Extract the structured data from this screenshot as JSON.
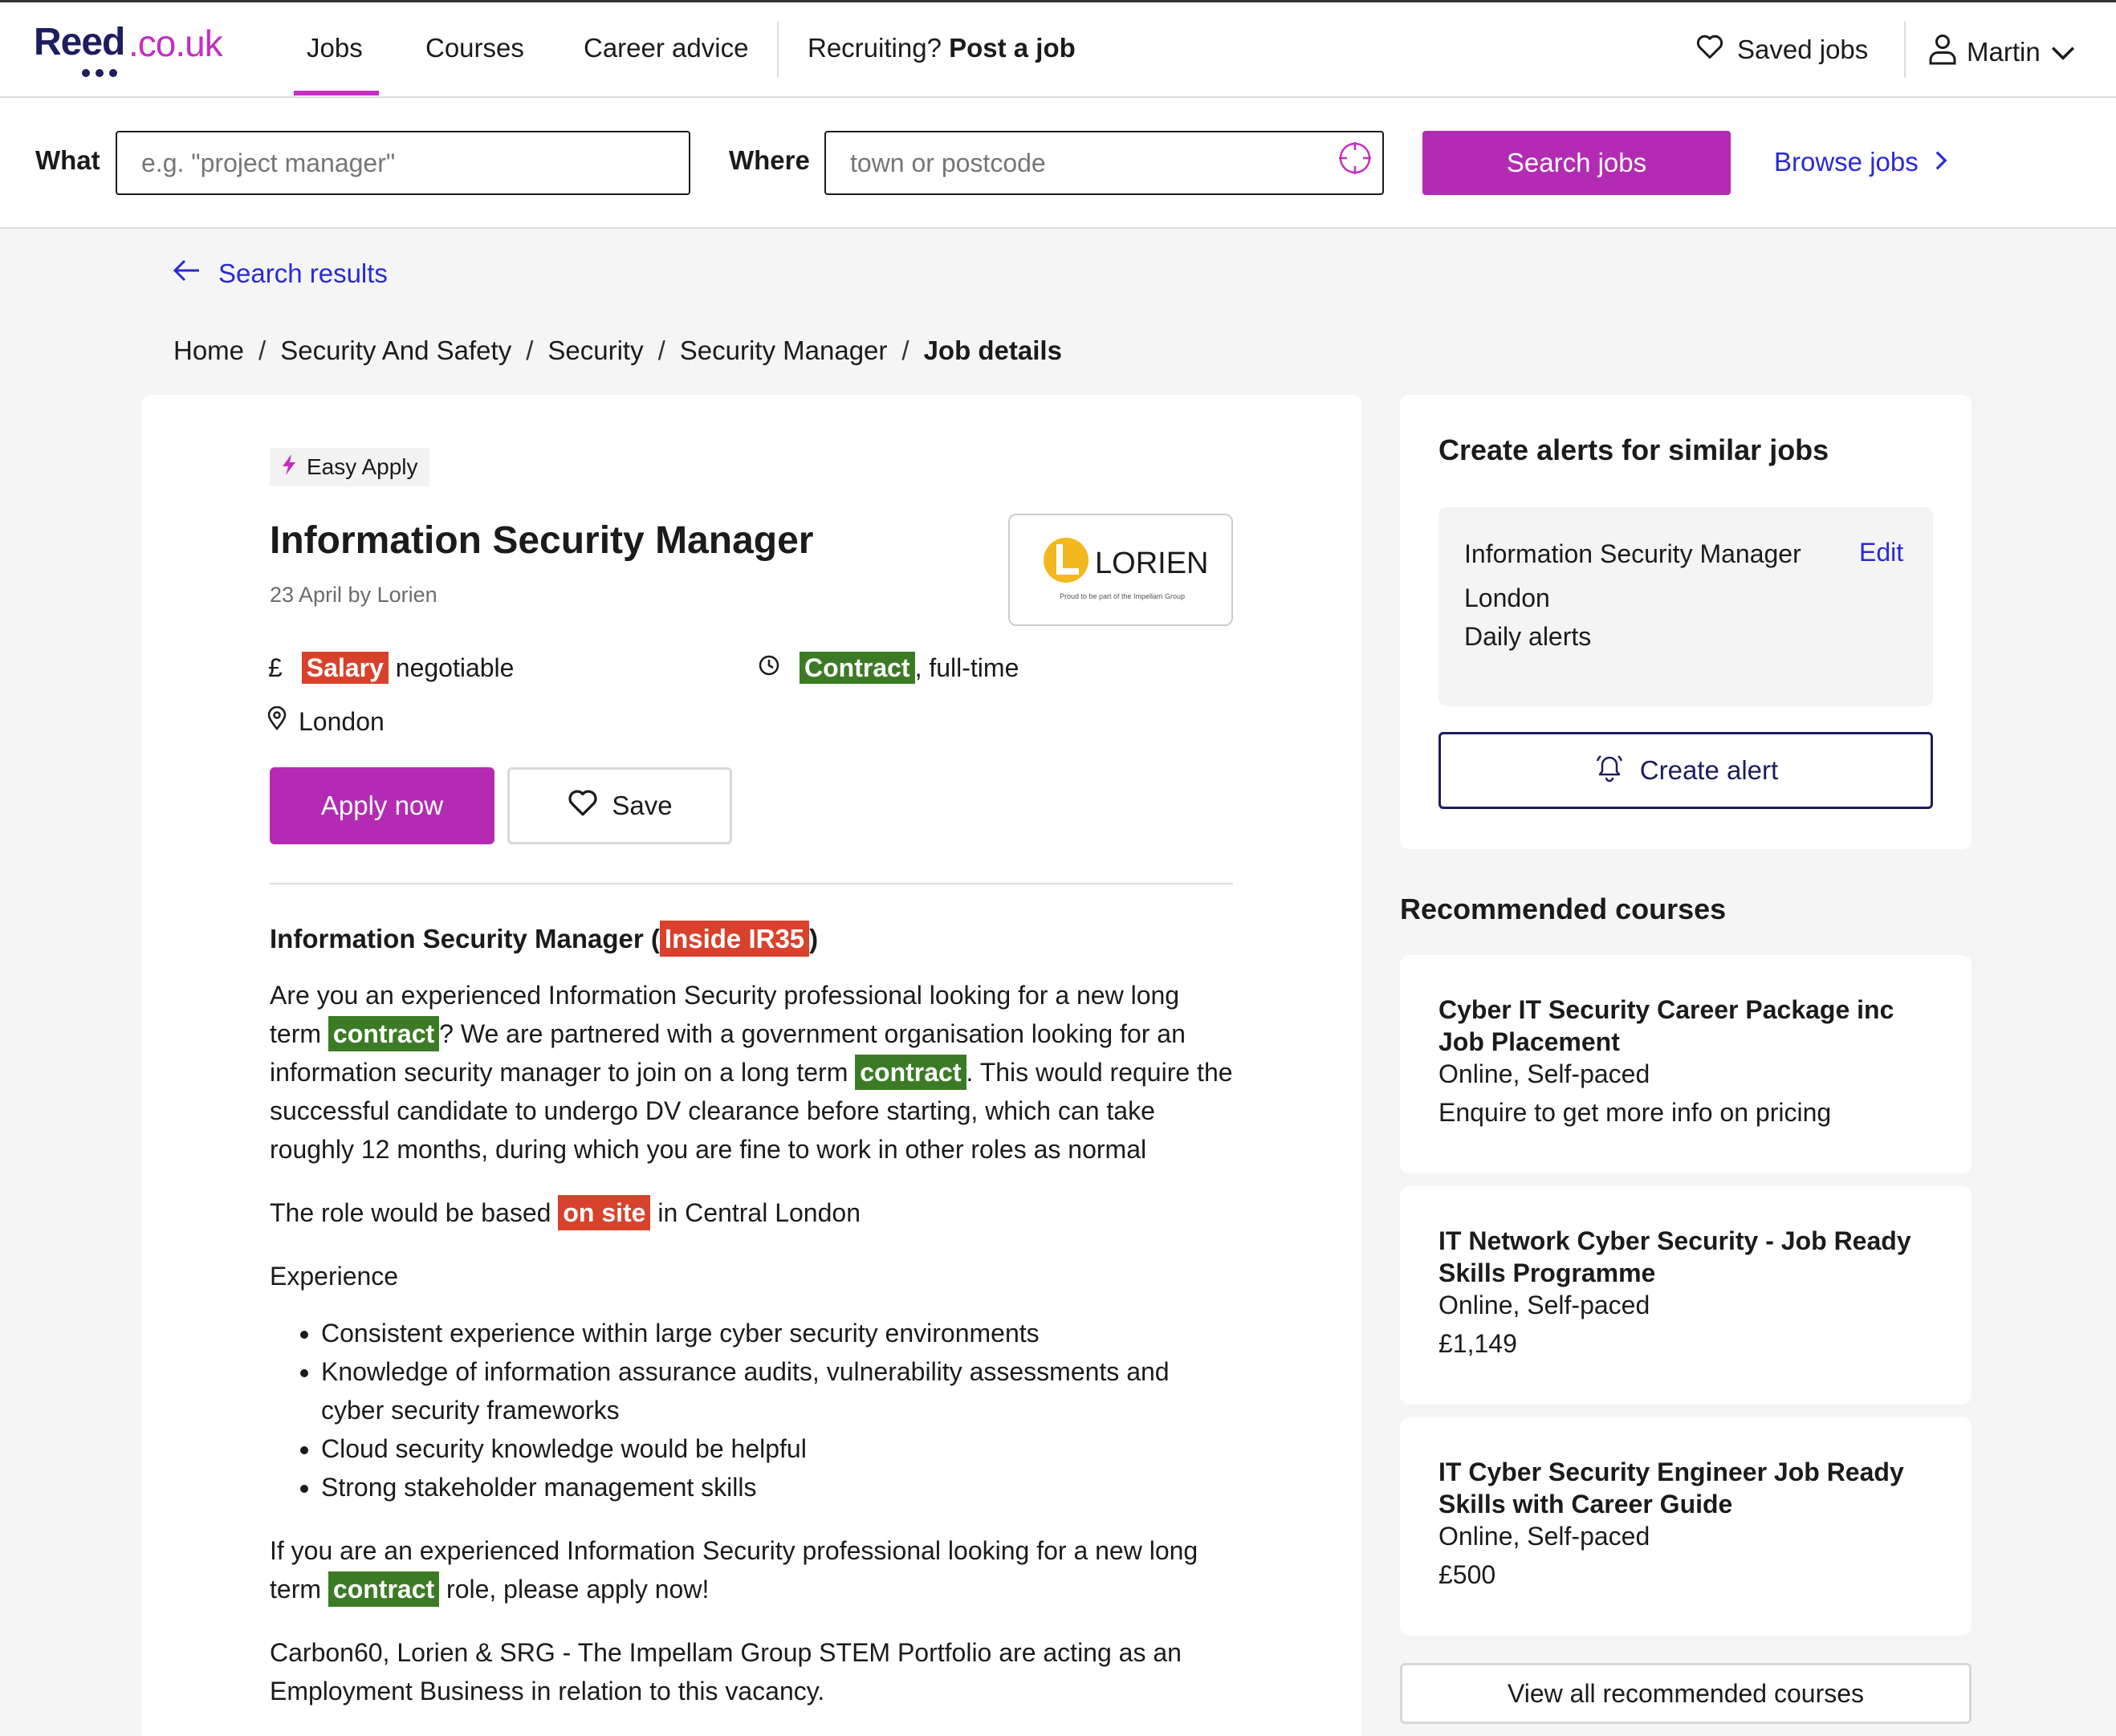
{
  "header": {
    "logo_main": "Reed",
    "logo_suffix": ".co.uk",
    "nav": [
      "Jobs",
      "Courses",
      "Career advice"
    ],
    "recruiting_prefix": "Recruiting?",
    "recruiting_link": "Post a job",
    "saved_jobs": "Saved jobs",
    "user_name": "Martin"
  },
  "search": {
    "what_label": "What",
    "what_placeholder": "e.g. \"project manager\"",
    "where_label": "Where",
    "where_placeholder": "town or postcode",
    "search_button": "Search jobs",
    "browse_link": "Browse jobs"
  },
  "back_link": "Search results",
  "breadcrumb": [
    "Home",
    "Security And Safety",
    "Security",
    "Security Manager",
    "Job details"
  ],
  "job": {
    "badge": "Easy Apply",
    "title": "Information Security Manager",
    "posted": "23 April by Lorien",
    "logo_text": "LORIEN",
    "logo_tagline": "Proud to be part of the Impellam Group",
    "salary_symbol": "£",
    "salary_hl": "Salary",
    "salary_text": "negotiable",
    "type_hl": "Contract",
    "type_text": ", full-time",
    "location": "London",
    "apply_button": "Apply now",
    "save_button": "Save"
  },
  "description": {
    "heading_prefix": "Information Security Manager (",
    "heading_hl": "Inside IR35",
    "heading_suffix": ")",
    "p1_a": "Are you an experienced Information Security professional looking for a new long term ",
    "p1_hl1": "contract",
    "p1_b": "? We are partnered with a government organisation looking for an information security manager to join on a long term ",
    "p1_hl2": "contract",
    "p1_c": ". This would require the successful candidate to undergo DV clearance before starting, which can take roughly 12 months, during which you are fine to work in other roles as normal",
    "p2_a": "The role would be based ",
    "p2_hl": "on site",
    "p2_b": " in Central London",
    "p3": "Experience",
    "bullets": [
      "Consistent experience within large cyber security environments",
      "Knowledge of information assurance audits, vulnerability assessments and cyber security frameworks",
      "Cloud security knowledge would be helpful",
      "Strong stakeholder management skills"
    ],
    "p4_a": "If you are an experienced Information Security professional looking for a new long term ",
    "p4_hl": "contract",
    "p4_b": " role, please apply now!",
    "p5": "Carbon60, Lorien & SRG - The Impellam Group STEM Portfolio are acting as an Employment Business in relation to this vacancy."
  },
  "alerts": {
    "title": "Create alerts for similar jobs",
    "job": "Information Security Manager",
    "edit": "Edit",
    "location": "London",
    "frequency": "Daily alerts",
    "button": "Create alert"
  },
  "courses": {
    "title": "Recommended courses",
    "items": [
      {
        "name": "Cyber IT Security Career Package inc Job Placement",
        "mode": "Online, Self-paced",
        "price": "Enquire to get more info on pricing"
      },
      {
        "name": "IT Network Cyber Security - Job Ready Skills Programme",
        "mode": "Online, Self-paced",
        "price": "£1,149"
      },
      {
        "name": "IT Cyber Security Engineer Job Ready Skills with Career Guide",
        "mode": "Online, Self-paced",
        "price": "£500"
      }
    ],
    "view_all": "View all recommended courses"
  },
  "colors": {
    "brand_purple": "#b32bb3",
    "link_blue": "#2a2ad5",
    "highlight_red": "#d8412b",
    "highlight_green": "#3c7b25",
    "navy": "#1d1d5f"
  },
  "icons": [
    "heart-icon",
    "user-icon",
    "chevron-down-icon",
    "locate-icon",
    "chevron-right-icon",
    "arrow-left-icon",
    "lightning-icon",
    "clock-icon",
    "location-pin-icon",
    "bell-icon"
  ]
}
